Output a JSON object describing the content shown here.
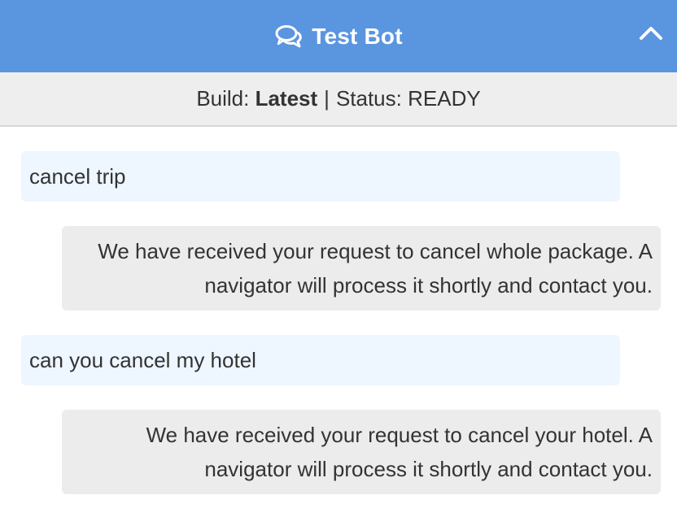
{
  "header": {
    "title": "Test Bot",
    "icon": "chat-bubbles-icon",
    "collapse_icon": "chevron-up-icon",
    "bg_color": "#5a95e0"
  },
  "status": {
    "build_label": "Build:",
    "build_value": "Latest",
    "separator": "|",
    "status_label": "Status:",
    "status_value": "READY"
  },
  "messages": [
    {
      "sender": "user",
      "text": "cancel trip"
    },
    {
      "sender": "bot",
      "text": "We have received your request to cancel whole package. A navigator will process it shortly and contact you."
    },
    {
      "sender": "user",
      "text": "can you cancel my hotel"
    },
    {
      "sender": "bot",
      "text": "We have received your request to cancel your hotel. A navigator will process it shortly and contact you."
    }
  ]
}
